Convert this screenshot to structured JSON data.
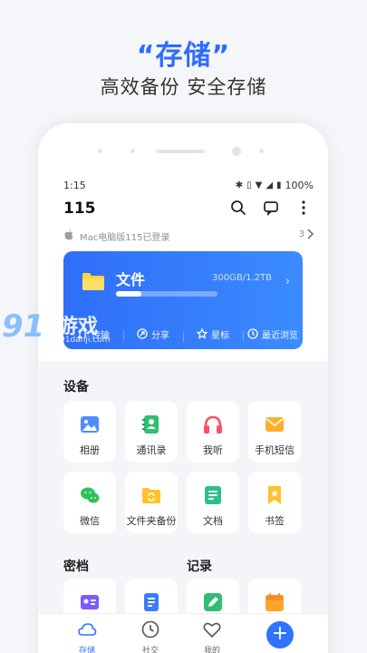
{
  "promo": {
    "title": "“存储”",
    "subtitle": "高效备份 安全存储"
  },
  "status_bar": {
    "time": "1:15",
    "battery": "100%"
  },
  "app_bar": {
    "title": "115"
  },
  "login_notice": {
    "text": "Mac电脑版115已登录",
    "count": "3"
  },
  "file_card": {
    "title": "文件",
    "storage": "300GB/1.2TB",
    "progress": 0.25,
    "actions": [
      {
        "label": "传输",
        "icon": "transfer-icon"
      },
      {
        "label": "分享",
        "icon": "share-icon"
      },
      {
        "label": "星标",
        "icon": "star-icon"
      },
      {
        "label": "最近浏览",
        "icon": "clock-icon"
      }
    ]
  },
  "devices": {
    "title": "设备",
    "items": [
      {
        "label": "相册",
        "icon": "photo-icon",
        "color": "#4d8dff"
      },
      {
        "label": "通讯录",
        "icon": "contacts-icon",
        "color": "#2fbf71"
      },
      {
        "label": "我听",
        "icon": "headphones-icon",
        "color": "#ff4d6a"
      },
      {
        "label": "手机短信",
        "icon": "mail-icon",
        "color": "#ffae2b"
      },
      {
        "label": "微信",
        "icon": "wechat-icon",
        "color": "#2fc25b"
      },
      {
        "label": "文件夹备份",
        "icon": "folder-sync-icon",
        "color": "#ffc22b"
      },
      {
        "label": "文档",
        "icon": "document-icon",
        "color": "#2fbf8a"
      },
      {
        "label": "书签",
        "icon": "bookmark-icon",
        "color": "#ffc22b"
      }
    ]
  },
  "vault": {
    "title": "密档"
  },
  "records": {
    "title": "记录"
  },
  "bottom_nav": {
    "items": [
      {
        "label": "存储",
        "icon": "cloud-icon",
        "active": true
      },
      {
        "label": "社交",
        "icon": "clock-icon"
      },
      {
        "label": "我的",
        "icon": "heart-icon"
      }
    ]
  },
  "watermark": {
    "number": "91",
    "text": "游戏",
    "url": "91danji.com"
  },
  "colors": {
    "accent": "#2f73ff",
    "card_start": "#2f6ef8",
    "card_end": "#3b8bff"
  }
}
